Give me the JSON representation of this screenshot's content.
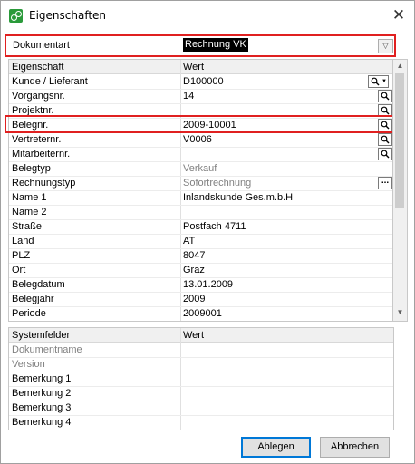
{
  "window": {
    "title": "Eigenschaften",
    "close_glyph": "✕"
  },
  "doctype": {
    "label": "Dokumentart",
    "value": "Rechnung VK",
    "dropdown_glyph": "▽"
  },
  "props": {
    "headers": {
      "name": "Eigenschaft",
      "value": "Wert"
    },
    "rows": [
      {
        "label": "Kunde / Lieferant",
        "value": "D100000"
      },
      {
        "label": "Vorgangsnr.",
        "value": "14"
      },
      {
        "label": "Projektnr.",
        "value": ""
      },
      {
        "label": "Belegnr.",
        "value": "2009-10001"
      },
      {
        "label": "Vertreternr.",
        "value": "V0006"
      },
      {
        "label": "Mitarbeiternr.",
        "value": ""
      },
      {
        "label": "Belegtyp",
        "value": "Verkauf"
      },
      {
        "label": "Rechnungstyp",
        "value": "Sofortrechnung"
      },
      {
        "label": "Name 1",
        "value": "Inlandskunde Ges.m.b.H"
      },
      {
        "label": "Name 2",
        "value": ""
      },
      {
        "label": "Straße",
        "value": "Postfach 4711"
      },
      {
        "label": "Land",
        "value": "AT"
      },
      {
        "label": "PLZ",
        "value": "8047"
      },
      {
        "label": "Ort",
        "value": "Graz"
      },
      {
        "label": "Belegdatum",
        "value": "13.01.2009"
      },
      {
        "label": "Belegjahr",
        "value": "2009"
      },
      {
        "label": "Periode",
        "value": "2009001"
      }
    ],
    "ellipsis_glyph": "...",
    "lookup_dd_glyph": "▼"
  },
  "scroll": {
    "up_glyph": "▲",
    "down_glyph": "▼"
  },
  "sysfields": {
    "headers": {
      "name": "Systemfelder",
      "value": "Wert"
    },
    "rows": [
      {
        "label": "Dokumentname",
        "value": ""
      },
      {
        "label": "Version",
        "value": ""
      },
      {
        "label": "Bemerkung 1",
        "value": ""
      },
      {
        "label": "Bemerkung 2",
        "value": ""
      },
      {
        "label": "Bemerkung 3",
        "value": ""
      },
      {
        "label": "Bemerkung 4",
        "value": ""
      }
    ]
  },
  "buttons": {
    "ok": "Ablegen",
    "cancel": "Abbrechen"
  },
  "colors": {
    "highlight_border": "#e02020",
    "default_button_border": "#0078d7",
    "disabled_text": "#808080"
  }
}
